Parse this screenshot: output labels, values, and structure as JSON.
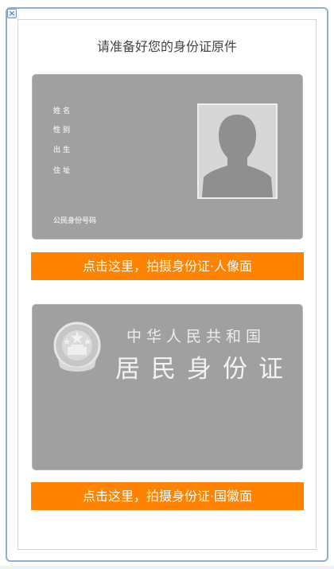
{
  "dialog": {
    "close_glyph": "×",
    "title": "请准备好您的身份证原件"
  },
  "front_card": {
    "fields": [
      "姓 名",
      "性 别",
      "出 生",
      "住 址"
    ],
    "id_number_label": "公民身份号码",
    "photo_icon": "person-silhouette-icon",
    "action_label": "点击这里，拍摄身份证·人像面"
  },
  "back_card": {
    "emblem_icon": "national-emblem-icon",
    "country": "中华人民共和国",
    "document_type": "居民身份证",
    "action_label": "点击这里，拍摄身份证·国徽面"
  },
  "colors": {
    "card_gray": "#a0a0a0",
    "action_orange": "#ff8200",
    "frame_blue": "#8fb0d4"
  }
}
